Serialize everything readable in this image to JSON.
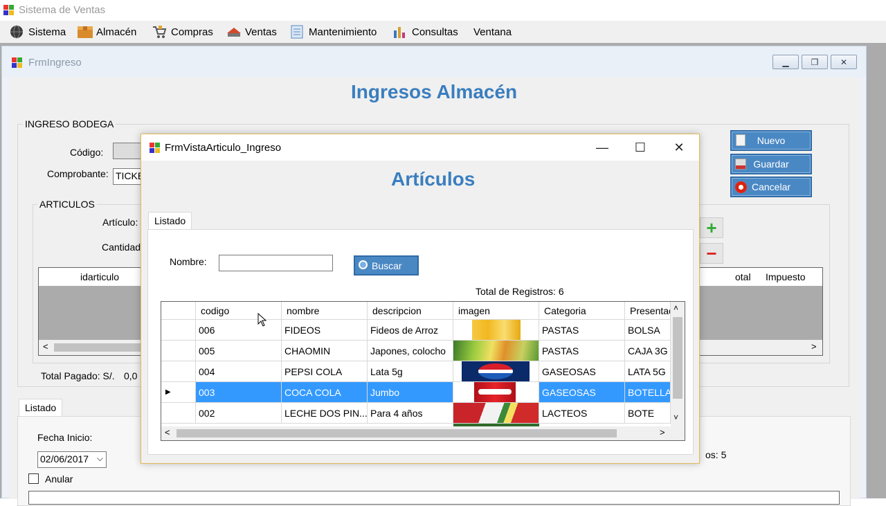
{
  "app": {
    "title": "Sistema de Ventas"
  },
  "menu": {
    "items": [
      {
        "label": "Sistema",
        "icon": "globe-icon"
      },
      {
        "label": "Almacén",
        "icon": "box-icon"
      },
      {
        "label": "Compras",
        "icon": "cart-icon"
      },
      {
        "label": "Ventas",
        "icon": "cash-icon"
      },
      {
        "label": "Mantenimiento",
        "icon": "document-icon"
      },
      {
        "label": "Consultas",
        "icon": "chart-icon"
      },
      {
        "label": "Ventana",
        "icon": ""
      }
    ]
  },
  "frm": {
    "title": "FrmIngreso",
    "heading": "Ingresos Almacén",
    "group_bodega": "INGRESO BODEGA",
    "codigo_label": "Código:",
    "comprobante_label": "Comprobante:",
    "comprobante_value": "TICKE",
    "group_articulos": "ARTICULOS",
    "articulo_label": "Artículo:",
    "cantidad_label": "Cantidad",
    "grid_cols": [
      "idarticulo",
      "otal",
      "Impuesto"
    ],
    "total_pagado_label": "Total Pagado: S/.",
    "total_pagado_value": "0,0",
    "buttons": {
      "nuevo": "Nuevo",
      "guardar": "Guardar",
      "cancelar": "Cancelar"
    },
    "listado_tab": "Listado",
    "fecha_inicio_label": "Fecha Inicio:",
    "fecha_inicio_value": "02/06/2017",
    "anular_label": "Anular",
    "registros_partial": "os: 5"
  },
  "dialog": {
    "title": "FrmVistaArticulo_Ingreso",
    "heading": "Artículos",
    "tab": "Listado",
    "nombre_label": "Nombre:",
    "nombre_value": "",
    "buscar_label": "Buscar",
    "total_registros": "Total de Registros: 6",
    "columns": [
      "codigo",
      "nombre",
      "descripcion",
      "imagen",
      "Categoria",
      "Presentac"
    ],
    "rows": [
      {
        "codigo": "006",
        "nombre": "FIDEOS",
        "descripcion": "Fideos de Arroz",
        "imagen": "noodles",
        "categoria": "PASTAS",
        "presentacion": "BOLSA",
        "selected": false
      },
      {
        "codigo": "005",
        "nombre": "CHAOMIN",
        "descripcion": "Japones, colocho",
        "imagen": "vegetables",
        "categoria": "PASTAS",
        "presentacion": "CAJA 3G",
        "selected": false
      },
      {
        "codigo": "004",
        "nombre": "PEPSI COLA",
        "descripcion": "Lata 5g",
        "imagen": "pepsi",
        "categoria": "GASEOSAS",
        "presentacion": "LATA 5G",
        "selected": false
      },
      {
        "codigo": "003",
        "nombre": "COCA COLA",
        "descripcion": "Jumbo",
        "imagen": "cocacola",
        "categoria": "GASEOSAS",
        "presentacion": "BOTELLA",
        "selected": true
      },
      {
        "codigo": "002",
        "nombre": "LECHE DOS PIN...",
        "descripcion": "Para 4 años",
        "imagen": "milk",
        "categoria": "LACTEOS",
        "presentacion": "BOTE",
        "selected": false
      }
    ]
  },
  "colors": {
    "accent_blue": "#3a7ebf",
    "button_blue": "#4a88c4",
    "selection": "#3399ff"
  }
}
